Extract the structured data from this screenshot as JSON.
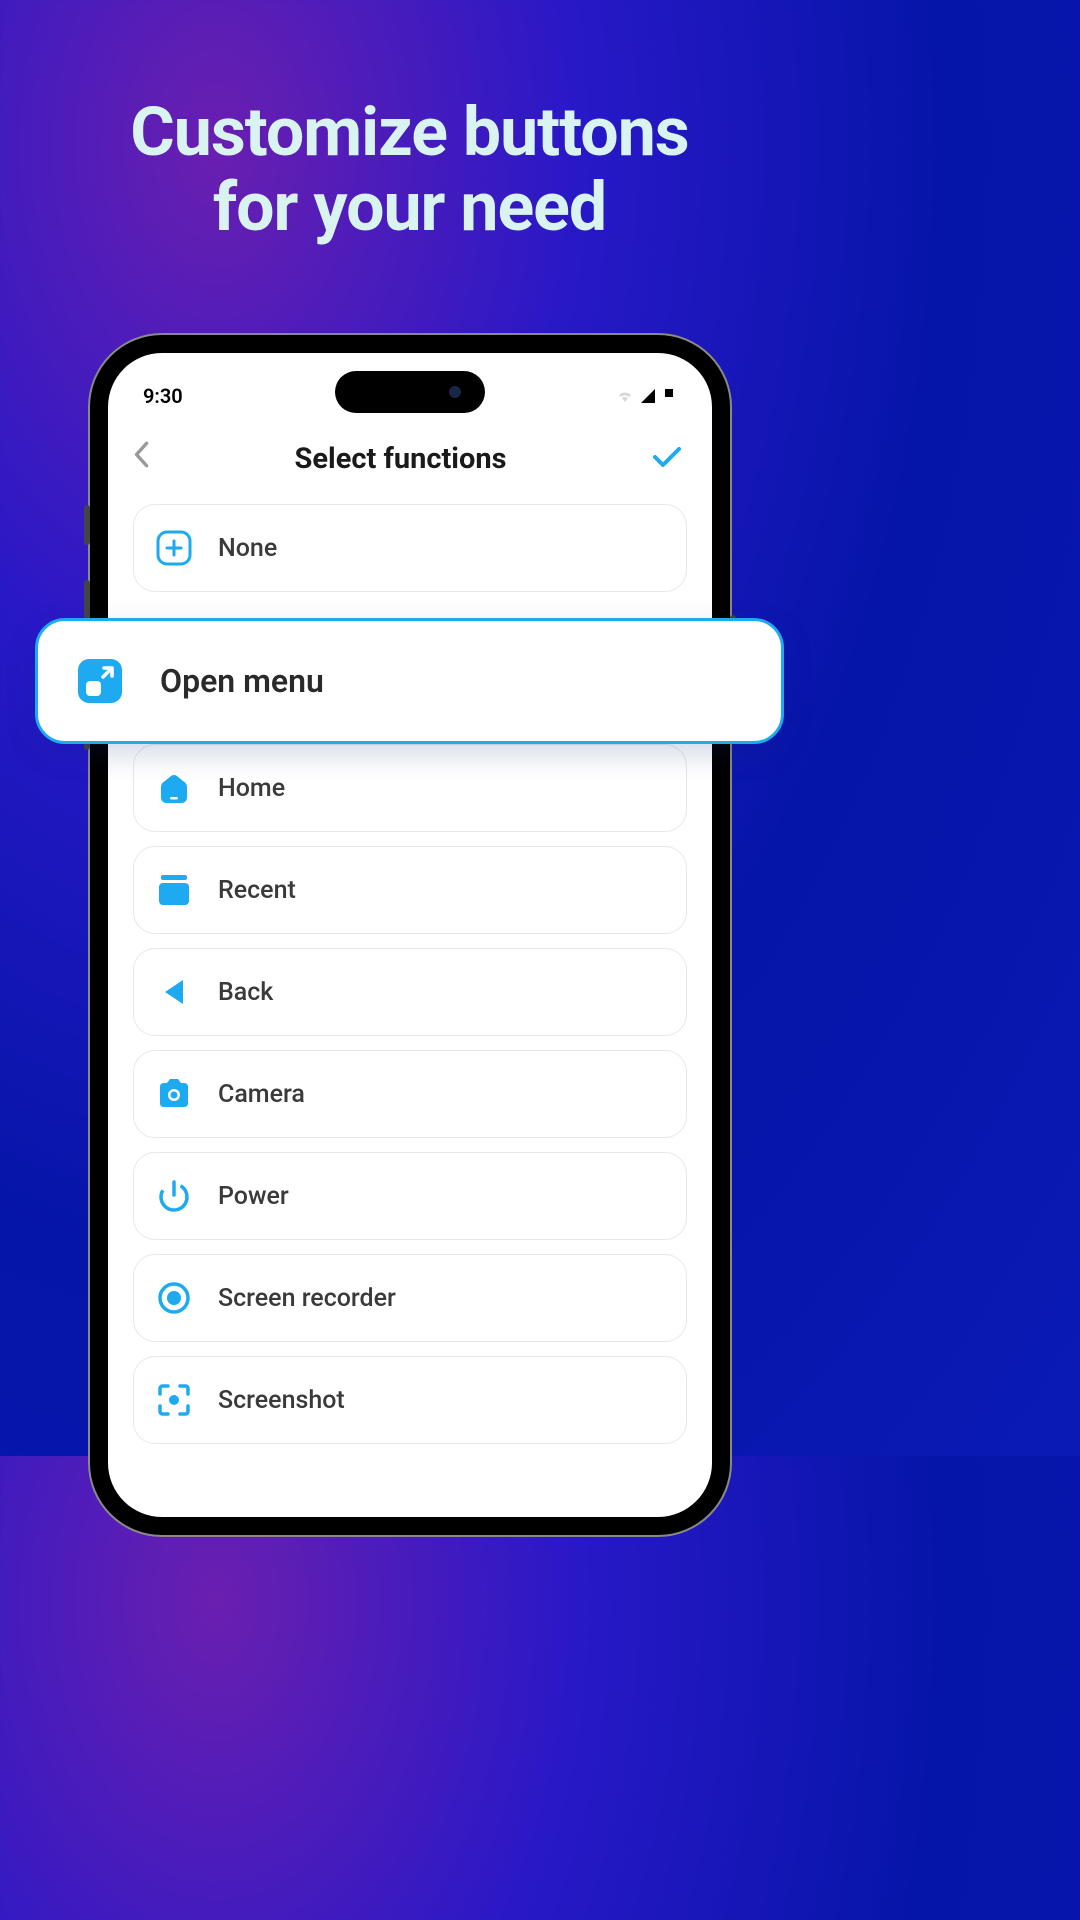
{
  "headline": {
    "line1": "Customize buttons",
    "line2": "for your need"
  },
  "status": {
    "time": "9:30"
  },
  "nav": {
    "title": "Select functions"
  },
  "highlight": {
    "label": "Open menu"
  },
  "items": [
    {
      "label": "None",
      "icon": "plus-outline"
    },
    {
      "label": "Home",
      "icon": "home"
    },
    {
      "label": "Recent",
      "icon": "recent"
    },
    {
      "label": "Back",
      "icon": "back-arrow"
    },
    {
      "label": "Camera",
      "icon": "camera"
    },
    {
      "label": "Power",
      "icon": "power"
    },
    {
      "label": "Screen recorder",
      "icon": "record"
    },
    {
      "label": "Screenshot",
      "icon": "screenshot"
    }
  ],
  "colors": {
    "accent": "#1eaaf1",
    "text": "#3a3a3a"
  }
}
